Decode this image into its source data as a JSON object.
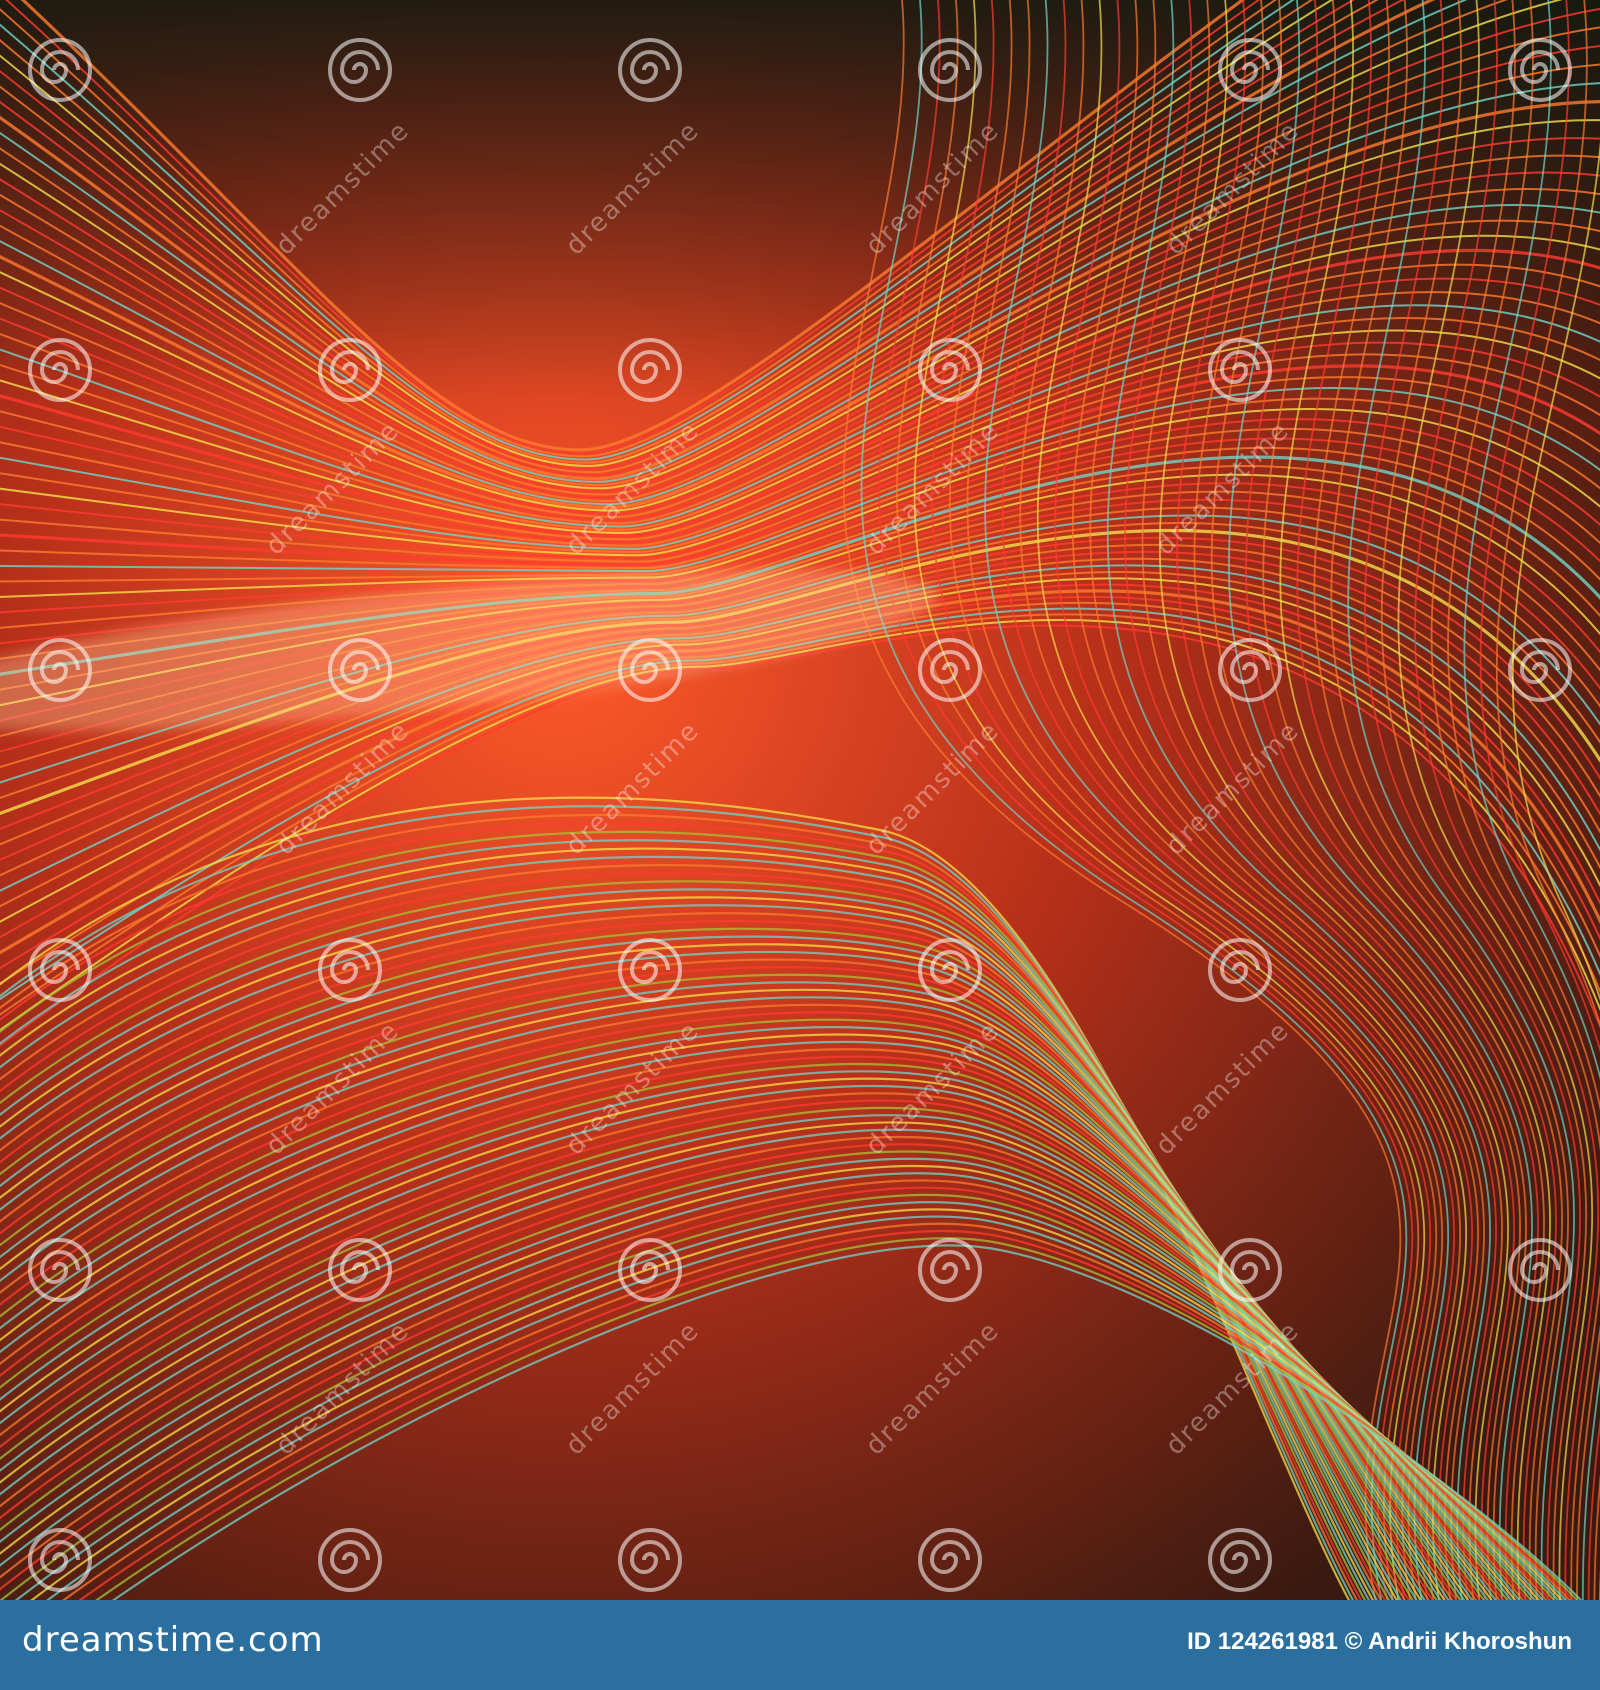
{
  "footer": {
    "logo_text": "dreamstime.com",
    "image_id": "ID 124261981",
    "copyright": "© Andrii Khoroshun"
  },
  "watermark": {
    "text": "dreamstime"
  },
  "colors": {
    "footer_bg": "#2b6f9e",
    "line_orange": "#ff7a2e",
    "line_red": "#ff3b30",
    "line_teal": "#6fd6c8",
    "line_yellow": "#f5e04a"
  },
  "artwork": {
    "description_icon": "abstract-wavy-lines"
  }
}
